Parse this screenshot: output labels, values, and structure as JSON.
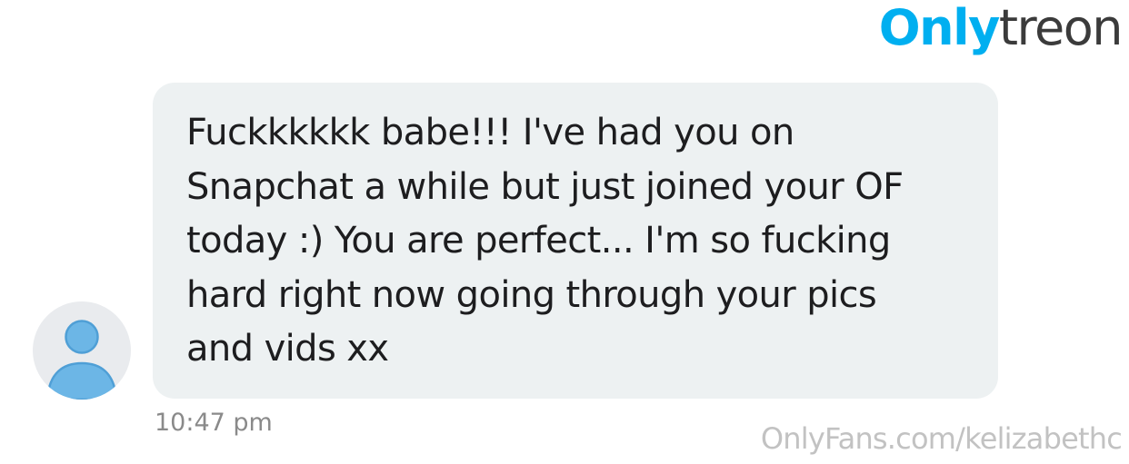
{
  "logo": {
    "part1": "Only",
    "part2": "treon"
  },
  "message": {
    "text": "Fuckkkkkk babe!!! I've had you on\nSnapchat a while but just joined your OF\ntoday :) You are perfect... I'm so fucking\nhard right now going through your pics\nand vids xx",
    "timestamp": "10:47 pm"
  },
  "avatar": {
    "icon": "user-placeholder-icon"
  },
  "watermark": {
    "text": "OnlyFans.com/kelizabethc"
  },
  "colors": {
    "logo_accent": "#00aff0",
    "logo_dark": "#3b3b3b",
    "bubble_background": "#edf1f2",
    "avatar_background": "#e9ebee",
    "avatar_figure": "#6cb6e6",
    "timestamp": "#8a8a8a",
    "watermark": "#c2c2c2"
  }
}
